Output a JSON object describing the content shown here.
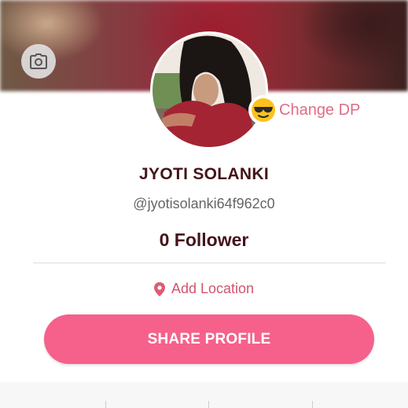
{
  "cover": {
    "camera_icon": "camera-icon"
  },
  "profile": {
    "avatar_icon": "profile-photo",
    "change_dp": {
      "emoji": "😎",
      "label": "Change DP"
    },
    "name": "JYOTI SOLANKI",
    "handle": "@jyotisolanki64f962c0",
    "followers": "0 Follower"
  },
  "location": {
    "icon": "location-pin-icon",
    "label": "Add Location"
  },
  "actions": {
    "share_label": "SHARE PROFILE"
  },
  "colors": {
    "accent_pink": "#f5618b",
    "location_pink": "#d2546f",
    "change_dp_pink": "#e06c88",
    "name_color": "#451419"
  }
}
